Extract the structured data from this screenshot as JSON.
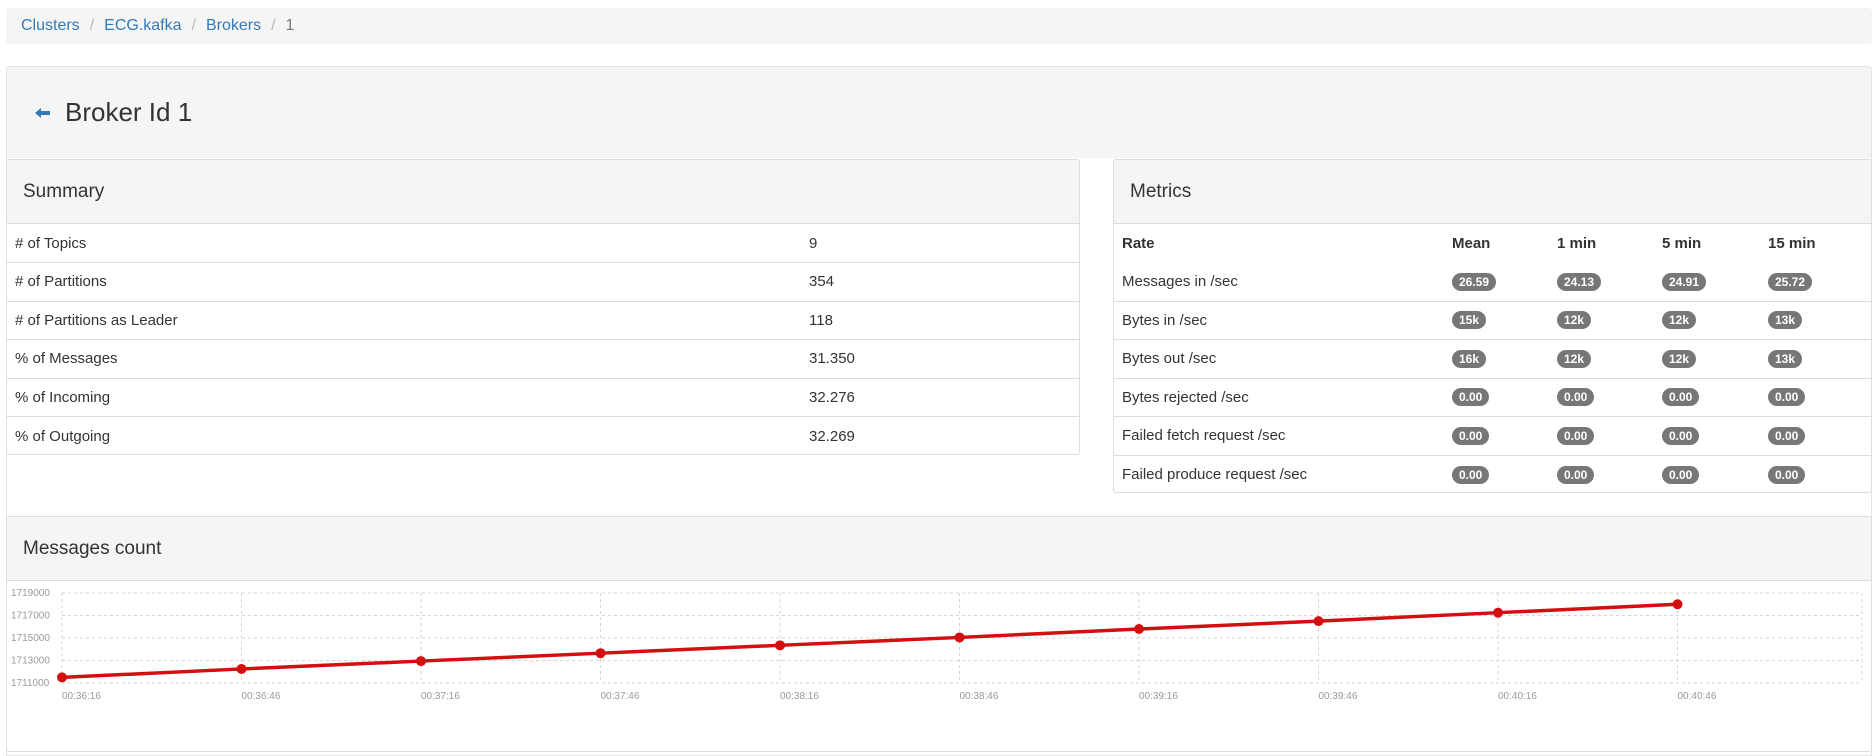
{
  "breadcrumb": {
    "items": [
      "Clusters",
      "ECG.kafka",
      "Brokers"
    ],
    "current": "1"
  },
  "header": {
    "title": "Broker Id 1"
  },
  "summary": {
    "title": "Summary",
    "rows": [
      {
        "label": "# of Topics",
        "value": "9"
      },
      {
        "label": "# of Partitions",
        "value": "354"
      },
      {
        "label": "# of Partitions as Leader",
        "value": "118"
      },
      {
        "label": "% of Messages",
        "value": "31.350"
      },
      {
        "label": "% of Incoming",
        "value": "32.276"
      },
      {
        "label": "% of Outgoing",
        "value": "32.269"
      }
    ]
  },
  "metrics": {
    "title": "Metrics",
    "headers": [
      "Rate",
      "Mean",
      "1 min",
      "5 min",
      "15 min"
    ],
    "rows": [
      {
        "label": "Messages in /sec",
        "values": [
          "26.59",
          "24.13",
          "24.91",
          "25.72"
        ]
      },
      {
        "label": "Bytes in /sec",
        "values": [
          "15k",
          "12k",
          "12k",
          "13k"
        ]
      },
      {
        "label": "Bytes out /sec",
        "values": [
          "16k",
          "12k",
          "12k",
          "13k"
        ]
      },
      {
        "label": "Bytes rejected /sec",
        "values": [
          "0.00",
          "0.00",
          "0.00",
          "0.00"
        ]
      },
      {
        "label": "Failed fetch request /sec",
        "values": [
          "0.00",
          "0.00",
          "0.00",
          "0.00"
        ]
      },
      {
        "label": "Failed produce request /sec",
        "values": [
          "0.00",
          "0.00",
          "0.00",
          "0.00"
        ]
      }
    ]
  },
  "messages_chart": {
    "title": "Messages count",
    "colors": {
      "line": "#d30f0f",
      "grid": "#d4d4d4",
      "tick": "#999999"
    }
  },
  "chart_data": {
    "type": "line",
    "title": "",
    "xlabel": "",
    "ylabel": "",
    "x": [
      "00:36:16",
      "00:36:46",
      "00:37:16",
      "00:37:46",
      "00:38:16",
      "00:38:46",
      "00:39:16",
      "00:39:46",
      "00:40:16",
      "00:40:46"
    ],
    "y_ticks": [
      "1711000",
      "1713000",
      "1715000",
      "1717000",
      "1719000"
    ],
    "ylim": [
      1711000,
      1719000
    ],
    "grid": true,
    "series": [
      {
        "values": [
          1711500,
          1712250,
          1712950,
          1713650,
          1714350,
          1715050,
          1715800,
          1716500,
          1717250,
          1718000
        ]
      }
    ]
  }
}
